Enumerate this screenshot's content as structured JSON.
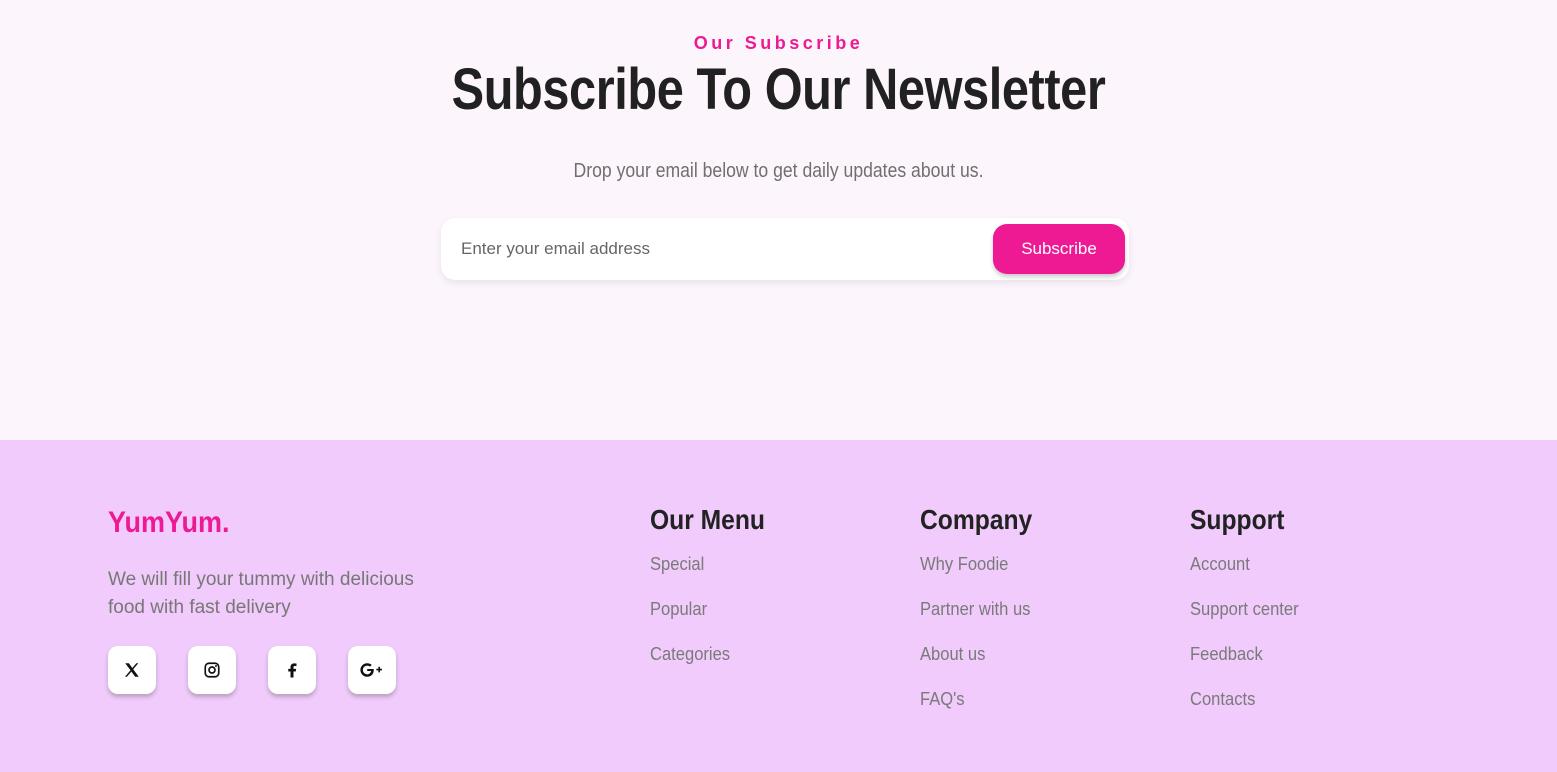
{
  "newsletter": {
    "eyebrow": "Our Subscribe",
    "title": "Subscribe To Our Newsletter",
    "subtitle": "Drop your email below to get daily updates about us.",
    "email_placeholder": "Enter your email address",
    "email_value": "",
    "button_label": "Subscribe"
  },
  "footer": {
    "brand": "YumYum.",
    "tagline": "We will fill your tummy with delicious food with fast delivery",
    "socials": [
      "x-icon",
      "instagram-icon",
      "facebook-icon",
      "google-plus-icon"
    ],
    "columns": [
      {
        "title": "Our Menu",
        "links": [
          "Special",
          "Popular",
          "Categories"
        ]
      },
      {
        "title": "Company",
        "links": [
          "Why Foodie",
          "Partner with us",
          "About us",
          "FAQ's"
        ]
      },
      {
        "title": "Support",
        "links": [
          "Account",
          "Support center",
          "Feedback",
          "Contacts"
        ]
      }
    ]
  },
  "colors": {
    "accent": "#ee1a94",
    "page_background": "#fdf5fc",
    "footer_background": "#f0cbfb",
    "heading": "#212121",
    "muted_text": "#777777"
  }
}
